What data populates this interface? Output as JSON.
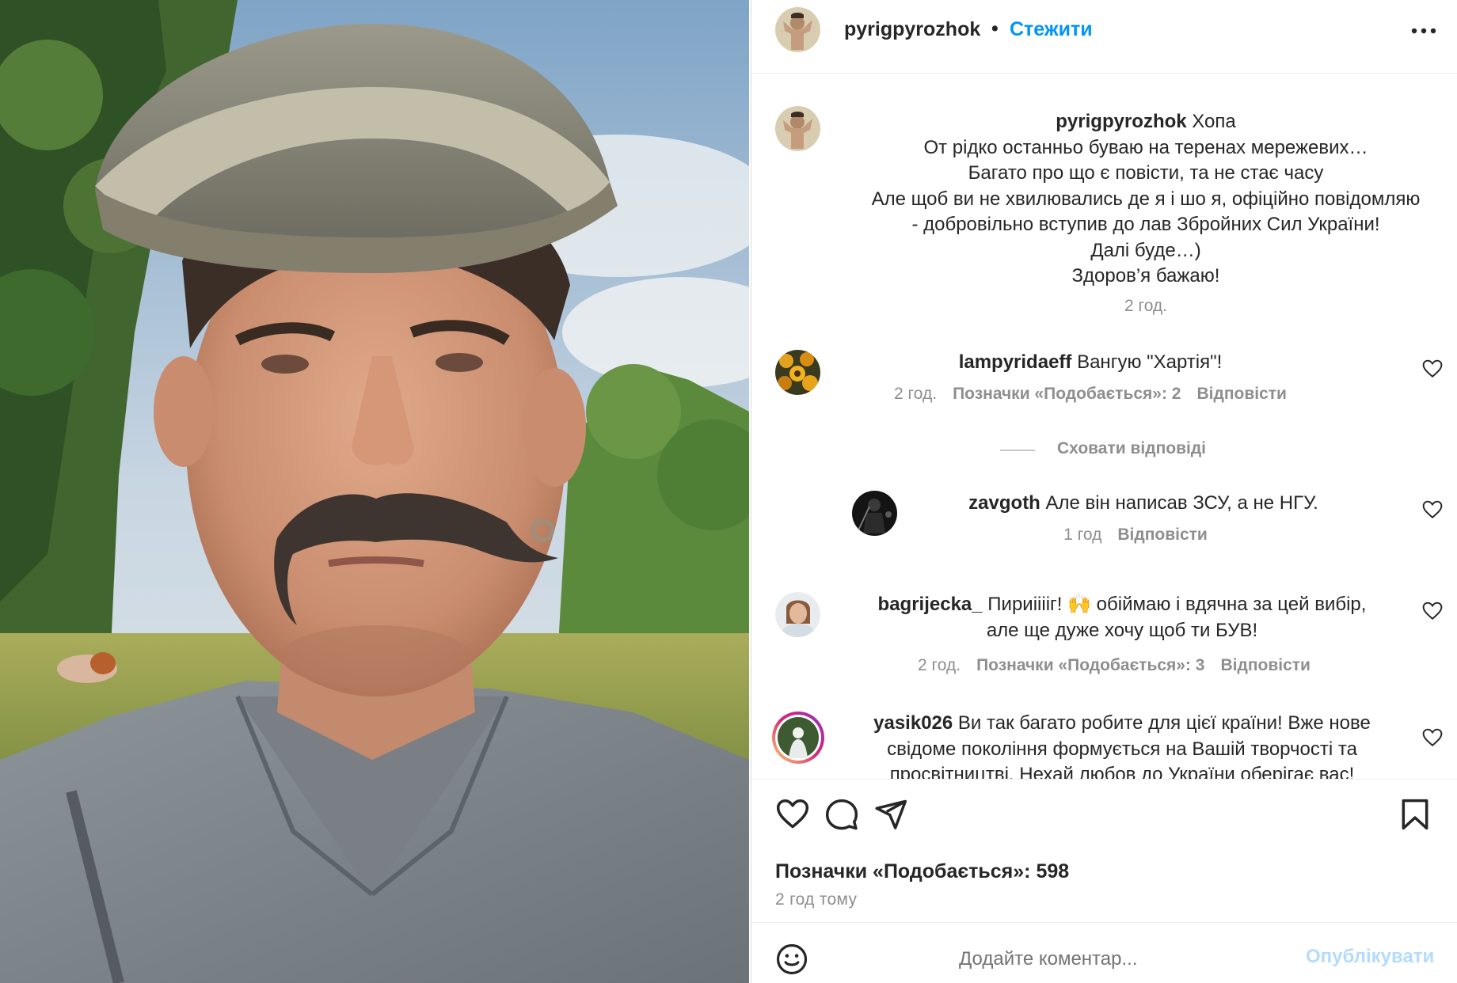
{
  "header": {
    "username": "pyrigpyrozhok",
    "separator": "•",
    "follow_label": "Стежити"
  },
  "caption": {
    "username": "pyrigpyrozhok",
    "lines": [
      "Хопа",
      "От рідко останньо буваю на теренах мережевих…",
      "Багато про що є повісти, та не стає часу",
      "Але щоб ви не хвилювались де я і шо я, офіційно повідомляю",
      "- добровільно вступив до лав Збройних Сил України!",
      "Далі буде…)",
      "Здоров’я бажаю!"
    ],
    "time": "2 год."
  },
  "comments": [
    {
      "username": "lampyridaeff",
      "text": "Вангую \"Хартія\"!",
      "time": "2 год.",
      "likes": "Позначки «Подобається»: 2",
      "reply": "Відповісти"
    },
    {
      "username": "zavgoth",
      "text": "Але він написав ЗСУ, а не НГУ.",
      "time": "1 год",
      "reply": "Відповісти"
    },
    {
      "username": "bagrijecka_",
      "text_line1": "Пириііііг! 🙌 обіймаю і вдячна за цей вибір,",
      "text_line2": "але ще дуже хочу щоб ти БУВ!",
      "time": "2 год.",
      "likes": "Позначки «Подобається»: 3",
      "reply": "Відповісти"
    },
    {
      "username": "yasik026",
      "text_line1": "Ви так багато робите для цієї країни! Вже нове",
      "text_line2": "свідоме покоління формується на Вашій творчості та",
      "text_line3": "просвітництві. Нехай любов до України оберігає вас!"
    }
  ],
  "hide_replies_label": "Сховати відповіді",
  "actions": {
    "likes_label": "Позначки «Подобається»: 598",
    "time_ago": "2 год тому"
  },
  "comment_box": {
    "placeholder": "Додайте коментар...",
    "publish_label": "Опублікувати"
  },
  "icons": {
    "more": "more-horizontal-icon",
    "like": "heart-icon",
    "comment": "comment-bubble-icon",
    "share": "paper-plane-icon",
    "save": "bookmark-icon",
    "emoji": "emoji-smile-icon"
  },
  "colors": {
    "link_blue": "#0095f6",
    "publish_disabled": "#b3dbff",
    "secondary_text": "#8e8e8e",
    "primary_text": "#262626"
  }
}
